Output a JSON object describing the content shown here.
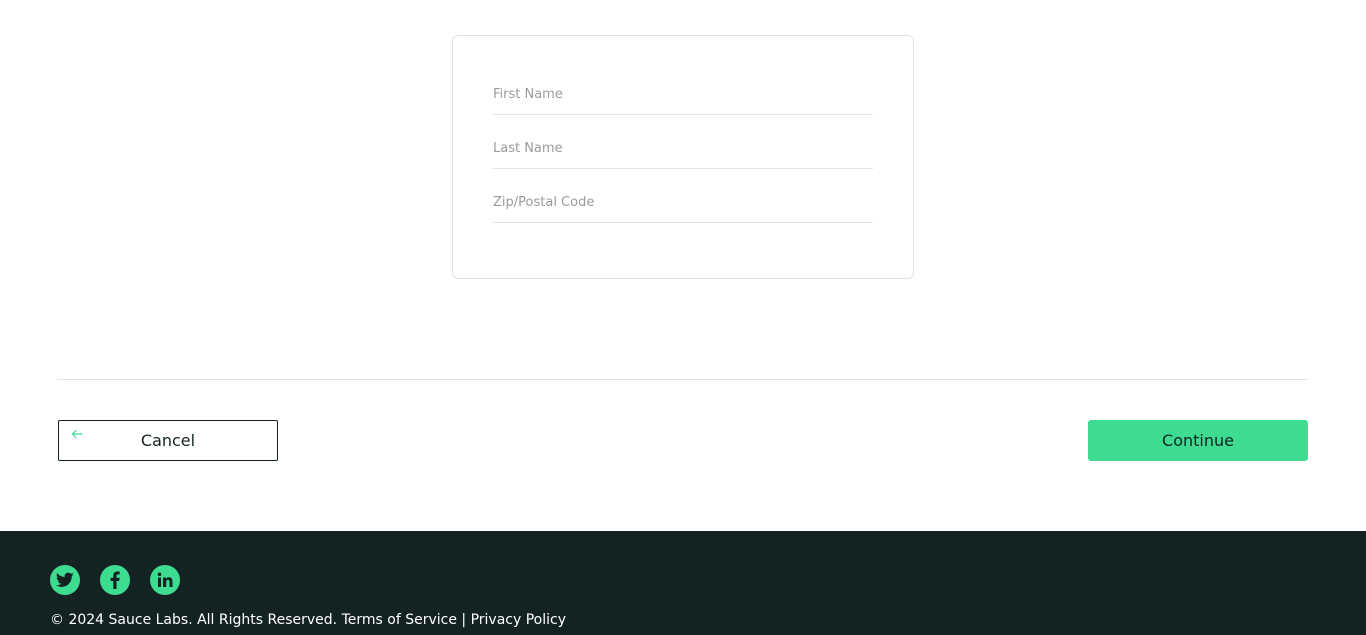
{
  "checkout_form": {
    "first_name": {
      "value": "",
      "placeholder": "First Name"
    },
    "last_name": {
      "value": "",
      "placeholder": "Last Name"
    },
    "postal_code": {
      "value": "",
      "placeholder": "Zip/Postal Code"
    }
  },
  "actions": {
    "cancel_label": "Cancel",
    "cancel_icon": "arrow-left-icon",
    "continue_label": "Continue"
  },
  "footer": {
    "social": [
      {
        "name": "twitter",
        "icon": "twitter-icon"
      },
      {
        "name": "facebook",
        "icon": "facebook-icon"
      },
      {
        "name": "linkedin",
        "icon": "linkedin-icon"
      }
    ],
    "copyright": "© 2024 Sauce Labs. All Rights Reserved.",
    "terms_label": "Terms of Service",
    "separator": "|",
    "privacy_label": "Privacy Policy"
  },
  "colors": {
    "accent": "#3ddc91",
    "dark": "#132322",
    "border": "#e2e2e2",
    "placeholder": "#9b9b9b"
  }
}
